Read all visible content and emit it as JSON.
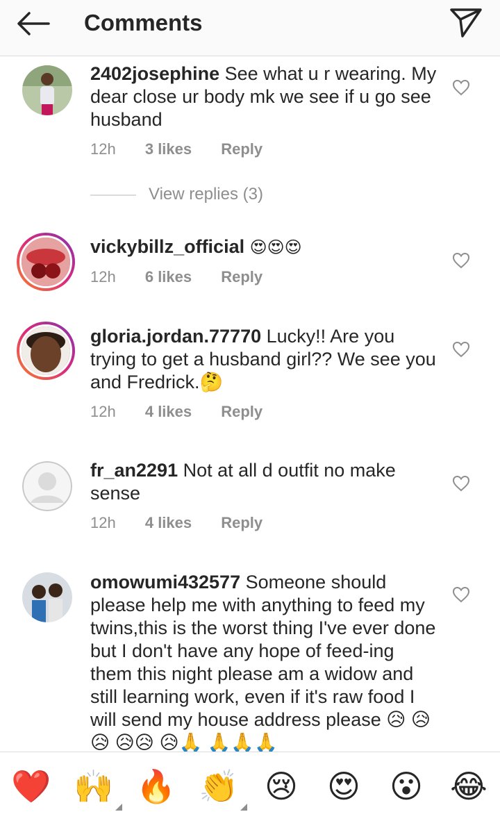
{
  "header": {
    "title": "Comments"
  },
  "comments": [
    {
      "username": "2402josephine",
      "text": "See what u r wearing. My dear close ur body mk we see if u go see husband",
      "time": "12h",
      "likes": "3 likes",
      "reply": "Reply"
    },
    {
      "username": "vickybillz_official",
      "text": "😍😍😍",
      "time": "12h",
      "likes": "6 likes",
      "reply": "Reply"
    },
    {
      "username": "gloria.jordan.77770",
      "text": "Lucky!! Are you trying to get a husband girl?? We see you and Fredrick.🤔",
      "time": "12h",
      "likes": "4 likes",
      "reply": "Reply"
    },
    {
      "username": "fr_an2291",
      "text": "Not at all d outfit no make sense",
      "time": "12h",
      "likes": "4 likes",
      "reply": "Reply"
    },
    {
      "username": "omowumi432577",
      "text": "Someone should please help me with anything to feed my twins,this is the worst thing I've ever done but I don't have any hope of feed-ing them this night please am a widow and still learning work, even if it's raw food I will send my house address please 😥 😥😥 😥😥 😥🙏 🙏🙏🙏"
    }
  ],
  "view_replies": "View replies (3)",
  "emoji_bar": [
    "❤️",
    "🙌",
    "🔥",
    "👏",
    "😢",
    "😍",
    "😮",
    "😂"
  ],
  "colors": {
    "ring_start": "#f58529",
    "ring_end": "#8134af",
    "text": "#262626",
    "meta": "#8e8e8e"
  }
}
